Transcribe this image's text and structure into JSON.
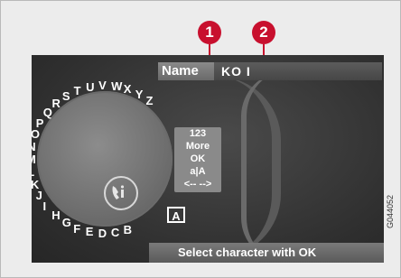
{
  "callouts": [
    {
      "label": "1"
    },
    {
      "label": "2"
    }
  ],
  "name_label": "Name",
  "name_value": "KO I",
  "wheel_letters": [
    "A",
    "B",
    "C",
    "D",
    "E",
    "F",
    "G",
    "H",
    "I",
    "J",
    "K",
    "L",
    "M",
    "N",
    "O",
    "P",
    "Q",
    "R",
    "S",
    "T",
    "U",
    "V",
    "W",
    "X",
    "Y",
    "Z"
  ],
  "menu_options": [
    "123",
    "More",
    "OK",
    "a|A",
    "<-- -->"
  ],
  "selected_letter": "A",
  "status_text": "Select character with OK",
  "figure_code": "G044052",
  "center_icon": "phone-info-icon",
  "colors": {
    "callout": "#c8102e"
  }
}
